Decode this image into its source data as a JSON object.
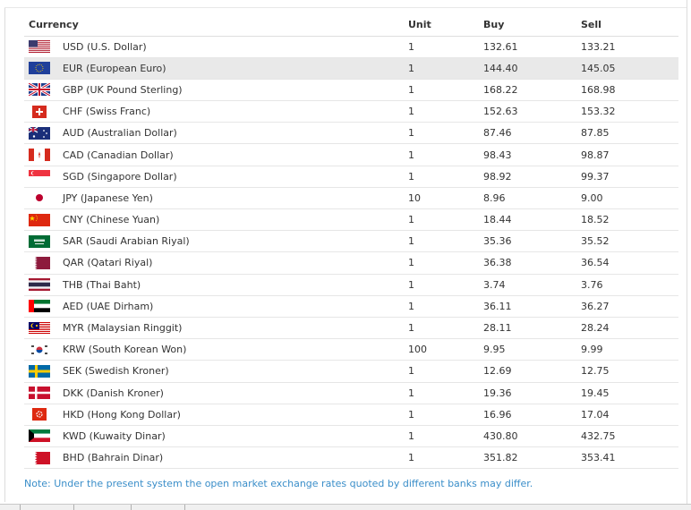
{
  "table": {
    "headers": {
      "currency": "Currency",
      "unit": "Unit",
      "buy": "Buy",
      "sell": "Sell"
    },
    "rows": [
      {
        "flag": "us-flag-icon",
        "name": "USD (U.S. Dollar)",
        "unit": "1",
        "buy": "132.61",
        "sell": "133.21"
      },
      {
        "flag": "eu-flag-icon",
        "name": "EUR (European Euro)",
        "unit": "1",
        "buy": "144.40",
        "sell": "145.05"
      },
      {
        "flag": "gb-flag-icon",
        "name": "GBP (UK Pound Sterling)",
        "unit": "1",
        "buy": "168.22",
        "sell": "168.98"
      },
      {
        "flag": "ch-flag-icon",
        "name": "CHF (Swiss Franc)",
        "unit": "1",
        "buy": "152.63",
        "sell": "153.32"
      },
      {
        "flag": "au-flag-icon",
        "name": "AUD (Australian Dollar)",
        "unit": "1",
        "buy": "87.46",
        "sell": "87.85"
      },
      {
        "flag": "ca-flag-icon",
        "name": "CAD (Canadian Dollar)",
        "unit": "1",
        "buy": "98.43",
        "sell": "98.87"
      },
      {
        "flag": "sg-flag-icon",
        "name": "SGD (Singapore Dollar)",
        "unit": "1",
        "buy": "98.92",
        "sell": "99.37"
      },
      {
        "flag": "jp-flag-icon",
        "name": "JPY (Japanese Yen)",
        "unit": "10",
        "buy": "8.96",
        "sell": "9.00"
      },
      {
        "flag": "cn-flag-icon",
        "name": "CNY (Chinese Yuan)",
        "unit": "1",
        "buy": "18.44",
        "sell": "18.52"
      },
      {
        "flag": "sa-flag-icon",
        "name": "SAR (Saudi Arabian Riyal)",
        "unit": "1",
        "buy": "35.36",
        "sell": "35.52"
      },
      {
        "flag": "qa-flag-icon",
        "name": "QAR (Qatari Riyal)",
        "unit": "1",
        "buy": "36.38",
        "sell": "36.54"
      },
      {
        "flag": "th-flag-icon",
        "name": "THB (Thai Baht)",
        "unit": "1",
        "buy": "3.74",
        "sell": "3.76"
      },
      {
        "flag": "ae-flag-icon",
        "name": "AED (UAE Dirham)",
        "unit": "1",
        "buy": "36.11",
        "sell": "36.27"
      },
      {
        "flag": "my-flag-icon",
        "name": "MYR (Malaysian Ringgit)",
        "unit": "1",
        "buy": "28.11",
        "sell": "28.24"
      },
      {
        "flag": "kr-flag-icon",
        "name": "KRW (South Korean Won)",
        "unit": "100",
        "buy": "9.95",
        "sell": "9.99"
      },
      {
        "flag": "se-flag-icon",
        "name": "SEK (Swedish Kroner)",
        "unit": "1",
        "buy": "12.69",
        "sell": "12.75"
      },
      {
        "flag": "dk-flag-icon",
        "name": "DKK (Danish Kroner)",
        "unit": "1",
        "buy": "19.36",
        "sell": "19.45"
      },
      {
        "flag": "hk-flag-icon",
        "name": "HKD (Hong Kong Dollar)",
        "unit": "1",
        "buy": "16.96",
        "sell": "17.04"
      },
      {
        "flag": "kw-flag-icon",
        "name": "KWD (Kuwaity Dinar)",
        "unit": "1",
        "buy": "430.80",
        "sell": "432.75"
      },
      {
        "flag": "bh-flag-icon",
        "name": "BHD (Bahrain Dinar)",
        "unit": "1",
        "buy": "351.82",
        "sell": "353.41"
      }
    ]
  },
  "note": "Note: Under the present system the open market exchange rates quoted by different banks may differ.",
  "colors": {
    "note": "#3a8ec9",
    "highlight_row": "#e9e9e9",
    "grid": "#e6e6e6"
  }
}
